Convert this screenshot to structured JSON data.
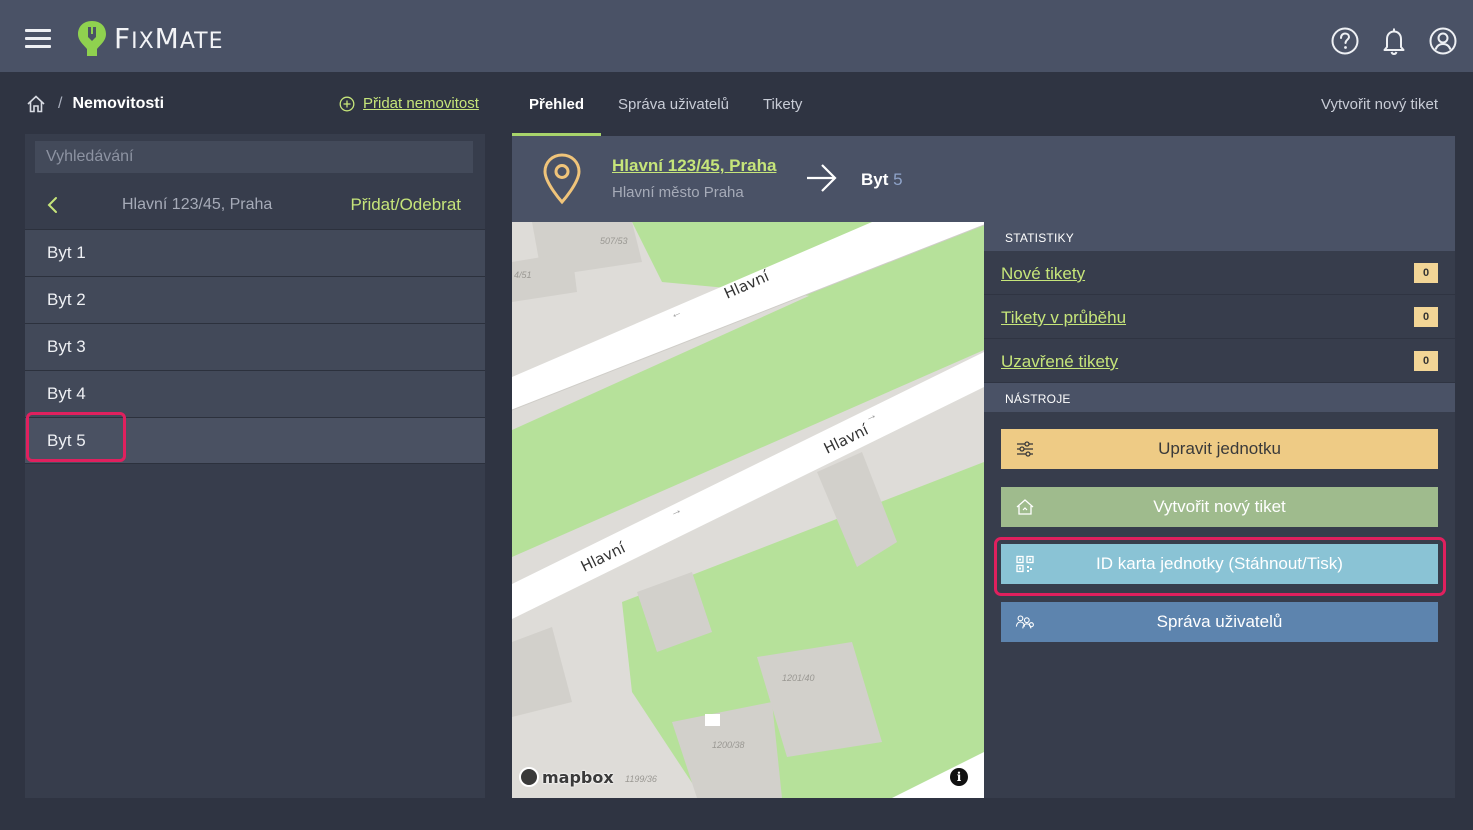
{
  "app": {
    "name": "FixMate",
    "logo_text": "FixMate",
    "colors": {
      "accent": "#c6e57a",
      "topbar": "#4a5266",
      "background": "#2f3442",
      "highlight": "#e0205e"
    }
  },
  "topbar": {
    "icons": [
      "menu-icon",
      "help-icon",
      "bell-icon",
      "user-icon"
    ]
  },
  "breadcrumb": {
    "current": "Nemovitosti"
  },
  "add_property": {
    "label": "Přidat nemovitost"
  },
  "tabs": [
    {
      "label": "Přehled",
      "active": true
    },
    {
      "label": "Správa uživatelů",
      "active": false
    },
    {
      "label": "Tikety",
      "active": false
    }
  ],
  "create_ticket_link": "Vytvořit nový tiket",
  "sidebar": {
    "search_placeholder": "Vyhledávání",
    "nav_title": "Hlavní 123/45, Praha",
    "nav_action": "Přidat/Odebrat",
    "units": [
      {
        "label": "Byt 1"
      },
      {
        "label": "Byt 2"
      },
      {
        "label": "Byt 3"
      },
      {
        "label": "Byt 4"
      },
      {
        "label": "Byt 5",
        "selected": true
      }
    ]
  },
  "header": {
    "address_link": "Hlavní 123/45, Praha",
    "address_sub": "Hlavní město Praha",
    "unit_prefix": "Byt",
    "unit_number": "5"
  },
  "map": {
    "street_labels": [
      "Hlavní",
      "Hlavní",
      "Hlavní"
    ],
    "parcel_labels": [
      "507/53",
      "4/51",
      "1201/40",
      "1200/38",
      "1199/36"
    ],
    "attribution": "mapbox",
    "info": "i"
  },
  "stats": {
    "title": "STATISTIKY",
    "rows": [
      {
        "label": "Nové tikety",
        "count": "0"
      },
      {
        "label": "Tikety v průběhu",
        "count": "0"
      },
      {
        "label": "Uzavřené tikety",
        "count": "0"
      }
    ]
  },
  "tools": {
    "title": "NÁSTROJE",
    "buttons": [
      {
        "label": "Upravit jednotku",
        "icon": "sliders-icon"
      },
      {
        "label": "Vytvořit nový tiket",
        "icon": "house-icon"
      },
      {
        "label": "ID karta jednotky (Stáhnout/Tisk)",
        "icon": "qr-icon"
      },
      {
        "label": "Správa uživatelů",
        "icon": "users-icon"
      }
    ]
  }
}
